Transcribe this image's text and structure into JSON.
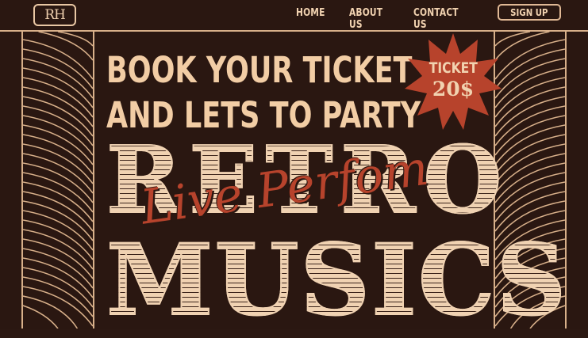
{
  "brand": {
    "logo_text": "RH"
  },
  "nav": {
    "home": "HOME",
    "about": "ABOUT US",
    "contact": "CONTACT US",
    "signup": "SIGN UP"
  },
  "hero": {
    "line1": "BOOK YOUR TICKET",
    "line2": "AND LETS TO PARTY",
    "word1": "RETRO",
    "script": "Live Perfom",
    "word2": "MUSICS"
  },
  "badge": {
    "label": "TICKET",
    "price": "20$"
  },
  "colors": {
    "background": "#2a1711",
    "cream": "#f0d2b2",
    "accent_red": "#b7432c",
    "line": "#d8b08a"
  }
}
